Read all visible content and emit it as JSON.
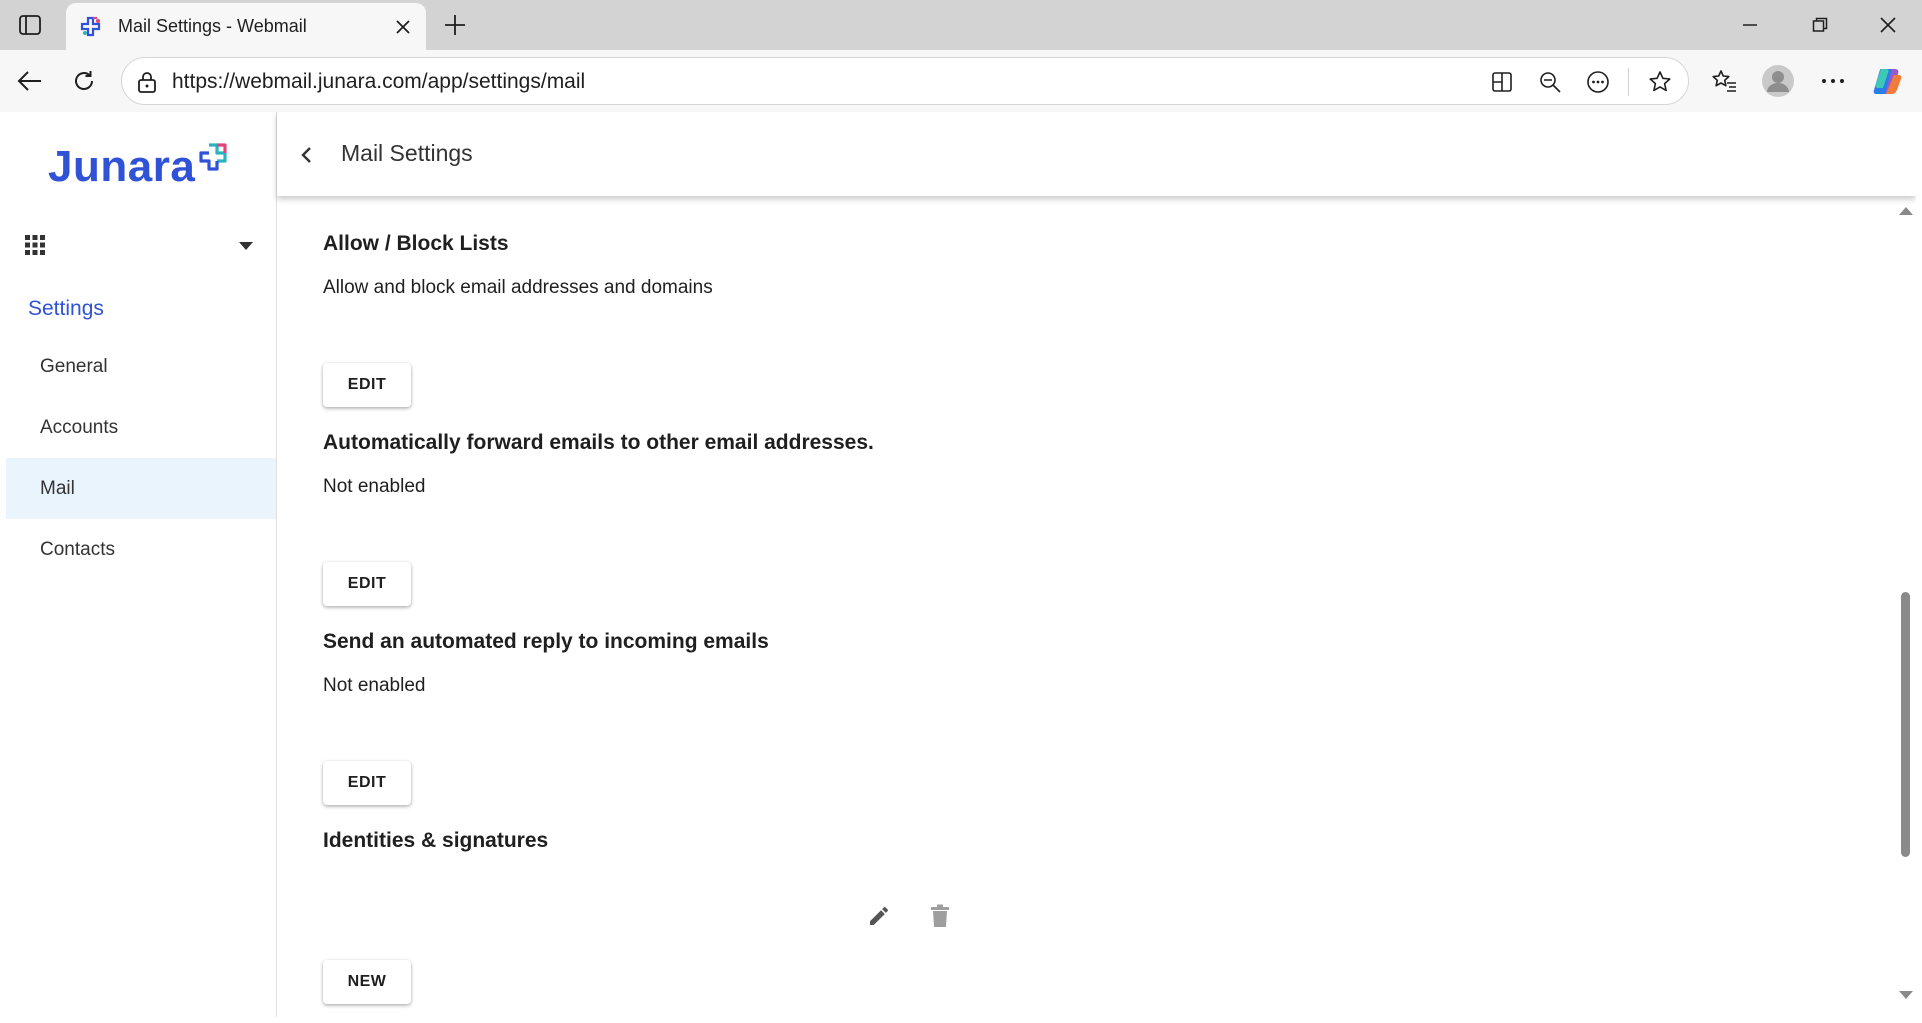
{
  "browser": {
    "tab_title": "Mail Settings - Webmail",
    "url": "https://webmail.junara.com/app/settings/mail",
    "icons": {
      "tab_actions": "tab-actions-icon",
      "favicon": "junara-favicon",
      "close_tab": "close-icon",
      "new_tab": "plus-icon",
      "back": "arrow-left-icon",
      "refresh": "refresh-icon",
      "site_info": "lock-icon",
      "split_screen": "split-screen-icon",
      "zoom": "zoom-out-icon",
      "more_page": "more-circle-icon",
      "favorite": "star-icon",
      "favorites": "favorites-list-icon",
      "profile": "profile-avatar-icon",
      "settings_more": "ellipsis-icon",
      "copilot": "copilot-icon",
      "minimize": "minimize-icon",
      "restore": "restore-icon",
      "close_window": "close-icon"
    }
  },
  "sidebar": {
    "logo_text": "Junara",
    "section_title": "Settings",
    "items": [
      {
        "label": "General",
        "active": false
      },
      {
        "label": "Accounts",
        "active": false
      },
      {
        "label": "Mail",
        "active": true
      },
      {
        "label": "Contacts",
        "active": false
      }
    ]
  },
  "header": {
    "title": "Mail Settings"
  },
  "sections": {
    "allow_block": {
      "title": "Allow / Block Lists",
      "description": "Allow and block email addresses and domains",
      "button": "EDIT"
    },
    "forward": {
      "title": "Automatically forward emails to other email addresses.",
      "status": "Not enabled",
      "button": "EDIT"
    },
    "auto_reply": {
      "title": "Send an automated reply to incoming emails",
      "status": "Not enabled",
      "button": "EDIT"
    },
    "identities": {
      "title": "Identities & signatures",
      "new_button": "NEW"
    }
  },
  "colors": {
    "brand_blue": "#2f52d6",
    "active_nav_bg": "#eaf4fd",
    "chrome_bg": "#d3d3d3"
  }
}
